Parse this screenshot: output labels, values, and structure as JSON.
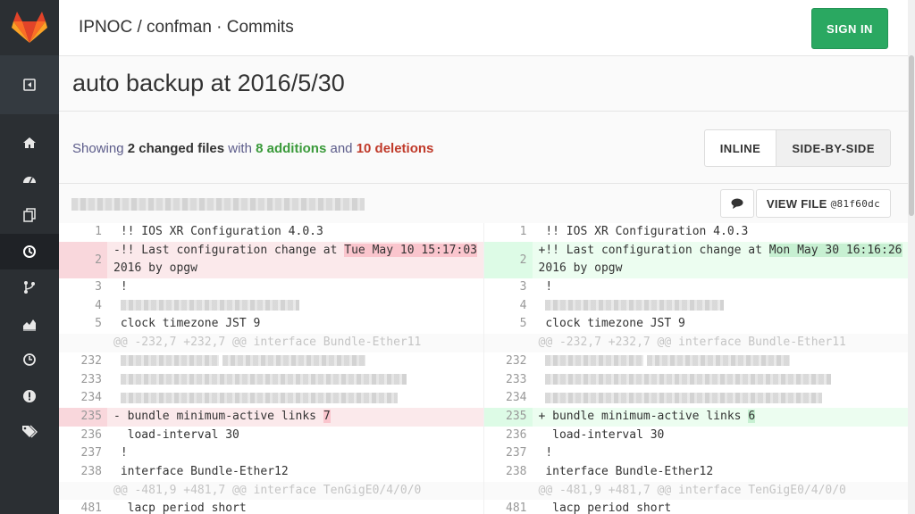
{
  "header": {
    "breadcrumb": "IPNOC / confman · Commits",
    "signin_label": "SIGN IN"
  },
  "sidebar": {
    "items": [
      {
        "name": "home-icon",
        "active": false
      },
      {
        "name": "dashboard-icon",
        "active": false
      },
      {
        "name": "files-icon",
        "active": false
      },
      {
        "name": "history-icon",
        "active": true
      },
      {
        "name": "branch-icon",
        "active": false
      },
      {
        "name": "graph-icon",
        "active": false
      },
      {
        "name": "clock-icon",
        "active": false
      },
      {
        "name": "issues-icon",
        "active": false
      },
      {
        "name": "tags-icon",
        "active": false
      }
    ]
  },
  "commit": {
    "title": "auto backup at 2016/5/30"
  },
  "stats": {
    "prefix": "Showing",
    "changed": "2 changed files",
    "with": "with",
    "additions": "8 additions",
    "and": "and",
    "deletions": "10 deletions"
  },
  "view_toggle": {
    "inline": "INLINE",
    "side_by_side": "SIDE-BY-SIDE"
  },
  "file": {
    "view_file_label": "VIEW FILE",
    "sha": "@81f60dc"
  },
  "diff": {
    "r1": {
      "ln": "1",
      "text": " !! IOS XR Configuration 4.0.3"
    },
    "r2": {
      "ln": "2",
      "old_pre": "-!! Last configuration change at ",
      "old_hl": "Tue May 10 15:17:03",
      "old_post": " 2016 by opgw",
      "new_pre": "+!! Last configuration change at ",
      "new_hl": "Mon May 30 16:16:26",
      "new_post": " 2016 by opgw"
    },
    "r3": {
      "ln": "3",
      "text": " !"
    },
    "r4": {
      "ln": "4"
    },
    "r5": {
      "ln": "5",
      "text": " clock timezone JST 9"
    },
    "h1": {
      "text": "@@ -232,7 +232,7 @@ interface Bundle-Ether11"
    },
    "r232": {
      "ln": "232"
    },
    "r233": {
      "ln": "233"
    },
    "r234": {
      "ln": "234"
    },
    "r235": {
      "ln": "235",
      "old_pre": "- bundle minimum-active links ",
      "old_hl": "7",
      "new_pre": "+ bundle minimum-active links ",
      "new_hl": "6"
    },
    "r236": {
      "ln": "236",
      "text": "  load-interval 30"
    },
    "r237": {
      "ln": "237",
      "text": " !"
    },
    "r238": {
      "ln": "238",
      "text": " interface Bundle-Ether12"
    },
    "h2": {
      "text": "@@ -481,9 +481,7 @@ interface TenGigE0/4/0/0"
    },
    "r481": {
      "ln": "481",
      "text": "  lacp period short"
    }
  }
}
